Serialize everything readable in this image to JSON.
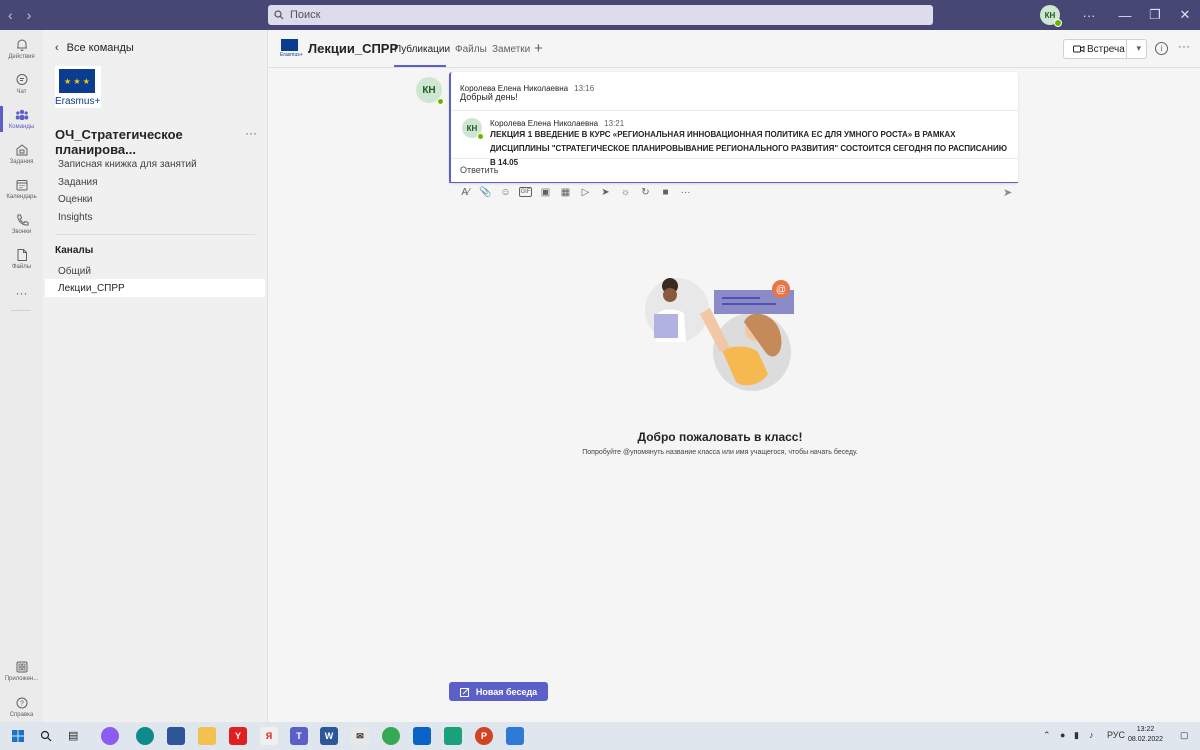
{
  "titlebar": {
    "search_placeholder": "Поиск",
    "avatar_initials": "КН",
    "more": "···",
    "minimize": "—",
    "restore": "❐",
    "close": "✕"
  },
  "appbar": {
    "items": [
      {
        "label": "Действия",
        "icon": "bell-icon"
      },
      {
        "label": "Чат",
        "icon": "chat-icon"
      },
      {
        "label": "Команды",
        "icon": "teams-icon"
      },
      {
        "label": "Задания",
        "icon": "assignments-icon"
      },
      {
        "label": "Календарь",
        "icon": "calendar-icon"
      },
      {
        "label": "Звонки",
        "icon": "phone-icon"
      },
      {
        "label": "Файлы",
        "icon": "file-icon"
      }
    ],
    "more": "···",
    "apps_label": "Приложен...",
    "help_label": "Справка"
  },
  "sidebar": {
    "back_label": "Все команды",
    "logo_text": "Erasmus+",
    "team_name": "ОЧ_Стратегическое планирова...",
    "team_more": "···",
    "menu": [
      "Записная книжка для занятий",
      "Задания",
      "Оценки",
      "Insights"
    ],
    "channels_title": "Каналы",
    "channels": [
      "Общий",
      "Лекции_СПРР"
    ]
  },
  "header": {
    "channel_title": "Лекции_СПРР",
    "flag_caption": "Erasmus+",
    "tabs": [
      "Публикации",
      "Файлы",
      "Заметки"
    ],
    "add_tab": "+",
    "meet_label": "Встреча",
    "info": "i",
    "more": "···"
  },
  "conversation": {
    "post": {
      "avatar": "КН",
      "author": "Королева Елена Николаевна",
      "time": "13:16",
      "text": "Добрый день!"
    },
    "reply": {
      "avatar": "КН",
      "author": "Королева Елена Николаевна",
      "time": "13:21",
      "lead": "ЛЕКЦИЯ 1",
      "text": " ВВЕДЕНИЕ В КУРС «РЕГИОНАЛЬНАЯ ИННОВАЦИОННАЯ ПОЛИТИКА ЕС ДЛЯ УМНОГО РОСТА» В РАМКАХ ДИСЦИПЛИНЫ \"СТРАТЕГИЧЕСКОЕ ПЛАНИРОВЫВАНИЕ РЕГИОНАЛЬНОГО РАЗВИТИЯ\" СОСТОИТСЯ СЕГОДНЯ ПО РАСПИСАНИЮ В 14.05"
    },
    "answer_label": "Ответить"
  },
  "welcome": {
    "title": "Добро пожаловать в класс!",
    "subtitle": "Попробуйте @упомянуть название класса или имя учащегося, чтобы начать беседу."
  },
  "new_conversation_label": "Новая беседа",
  "taskbar": {
    "language": "РУС",
    "time": "13:22",
    "date": "08.02.2022"
  }
}
